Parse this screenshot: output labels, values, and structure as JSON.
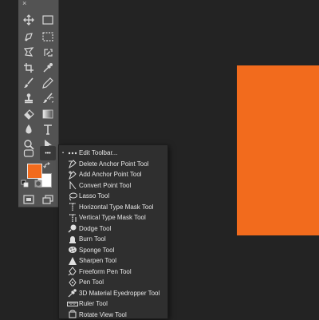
{
  "toolbar": {
    "close_glyph": "×",
    "tools": [
      {
        "name": "move-tool-icon",
        "selected": false
      },
      {
        "name": "artboard-marquee-icon",
        "selected": false
      },
      {
        "name": "lasso-tool-icon",
        "selected": false
      },
      {
        "name": "quick-selection-icon",
        "selected": false
      },
      {
        "name": "crop-tool-icon",
        "selected": false
      },
      {
        "name": "eyedropper-tool-icon",
        "selected": false
      },
      {
        "name": "brush-tool-icon",
        "selected": false
      },
      {
        "name": "pencil-tool-icon",
        "selected": false
      },
      {
        "name": "clone-stamp-icon",
        "selected": false
      },
      {
        "name": "history-brush-icon",
        "selected": false
      },
      {
        "name": "eraser-tool-icon",
        "selected": false
      },
      {
        "name": "gradient-tool-icon",
        "selected": false
      },
      {
        "name": "blur-tool-icon",
        "selected": false
      },
      {
        "name": "type-tool-icon",
        "selected": false
      },
      {
        "name": "zoom-tool-icon",
        "selected": false
      },
      {
        "name": "path-selection-icon",
        "selected": false
      },
      {
        "name": "shape-tool-icon",
        "selected": false
      },
      {
        "name": "more-tools-icon",
        "selected": true
      }
    ],
    "more_glyph": "•••",
    "foreground_color": "#f26b1d",
    "background_color": "#ffffff"
  },
  "canvas": {
    "shape_color": "#f26b1d"
  },
  "flyout": {
    "items": [
      {
        "label": "Edit Toolbar...",
        "icon": "edit-toolbar-icon",
        "bullet": "▪"
      },
      {
        "label": "Delete Anchor Point Tool",
        "icon": "delete-anchor-point-icon"
      },
      {
        "label": "Add Anchor Point Tool",
        "icon": "add-anchor-point-icon"
      },
      {
        "label": "Convert Point Tool",
        "icon": "convert-point-icon"
      },
      {
        "label": "Lasso Tool",
        "icon": "lasso-icon"
      },
      {
        "label": "Horizontal Type Mask Tool",
        "icon": "horizontal-type-mask-icon"
      },
      {
        "label": "Vertical Type Mask Tool",
        "icon": "vertical-type-mask-icon"
      },
      {
        "label": "Dodge Tool",
        "icon": "dodge-icon"
      },
      {
        "label": "Burn Tool",
        "icon": "burn-icon"
      },
      {
        "label": "Sponge Tool",
        "icon": "sponge-icon"
      },
      {
        "label": "Sharpen Tool",
        "icon": "sharpen-icon"
      },
      {
        "label": "Freeform Pen Tool",
        "icon": "freeform-pen-icon"
      },
      {
        "label": "Pen Tool",
        "icon": "pen-icon"
      },
      {
        "label": "3D Material Eyedropper Tool",
        "icon": "3d-material-eyedropper-icon"
      },
      {
        "label": "Ruler Tool",
        "icon": "ruler-icon"
      },
      {
        "label": "Rotate View Tool",
        "icon": "rotate-view-icon"
      }
    ]
  }
}
